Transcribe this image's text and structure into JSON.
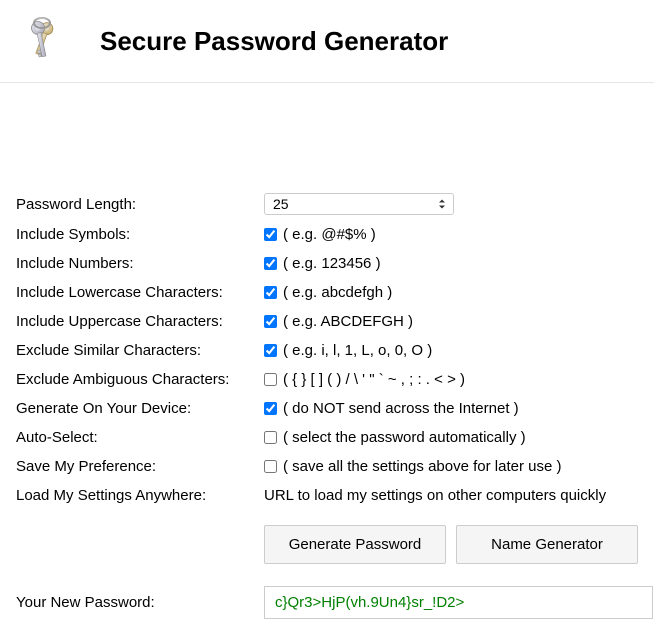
{
  "header": {
    "title": "Secure Password Generator",
    "icon": "keys-icon"
  },
  "form": {
    "length": {
      "label": "Password Length:",
      "value": "25"
    },
    "symbols": {
      "label": "Include Symbols:",
      "checked": true,
      "hint": "( e.g. @#$% )"
    },
    "numbers": {
      "label": "Include Numbers:",
      "checked": true,
      "hint": "( e.g. 123456 )"
    },
    "lowercase": {
      "label": "Include Lowercase Characters:",
      "checked": true,
      "hint": "( e.g. abcdefgh )"
    },
    "uppercase": {
      "label": "Include Uppercase Characters:",
      "checked": true,
      "hint": "( e.g. ABCDEFGH )"
    },
    "similar": {
      "label": "Exclude Similar Characters:",
      "checked": true,
      "hint": "( e.g. i, l, 1, L, o, 0, O )"
    },
    "ambiguous": {
      "label": "Exclude Ambiguous Characters:",
      "checked": false,
      "hint": "( { } [ ] ( ) / \\ ' \" ` ~ , ; : . < > )"
    },
    "device": {
      "label": "Generate On Your Device:",
      "checked": true,
      "hint": "( do NOT send across the Internet )"
    },
    "autoselect": {
      "label": "Auto-Select:",
      "checked": false,
      "hint": "( select the password automatically )"
    },
    "save": {
      "label": "Save My Preference:",
      "checked": false,
      "hint": "( save all the settings above for later use )"
    },
    "load": {
      "label": "Load My Settings Anywhere:",
      "text": "URL to load my settings on other computers quickly"
    }
  },
  "buttons": {
    "generate": "Generate Password",
    "name_generator": "Name Generator"
  },
  "output": {
    "label": "Your New Password:",
    "value": "c}Qr3>HjP(vh.9Un4}sr_!D2>"
  }
}
